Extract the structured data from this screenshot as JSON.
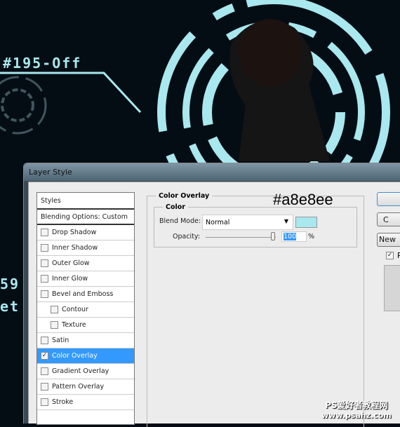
{
  "background": {
    "hud_label_top": "#195-Off",
    "hud_label_left_1": "59",
    "hud_label_left_2": "et",
    "accent": "#a8e8ee"
  },
  "dialog": {
    "title": "Layer Style",
    "styles_list": [
      {
        "label": "Styles",
        "type": "header"
      },
      {
        "label": "Blending Options: Custom",
        "type": "blend"
      },
      {
        "label": "Drop Shadow",
        "checked": false
      },
      {
        "label": "Inner Shadow",
        "checked": false
      },
      {
        "label": "Outer Glow",
        "checked": false
      },
      {
        "label": "Inner Glow",
        "checked": false
      },
      {
        "label": "Bevel and Emboss",
        "checked": false
      },
      {
        "label": "Contour",
        "checked": false,
        "sub": true
      },
      {
        "label": "Texture",
        "checked": false,
        "sub": true
      },
      {
        "label": "Satin",
        "checked": false
      },
      {
        "label": "Color Overlay",
        "checked": true,
        "selected": true
      },
      {
        "label": "Gradient Overlay",
        "checked": false
      },
      {
        "label": "Pattern Overlay",
        "checked": false
      },
      {
        "label": "Stroke",
        "checked": false
      }
    ],
    "panel": {
      "title": "Color Overlay",
      "group": "Color",
      "blend_mode_label": "Blend Mode:",
      "blend_mode": "Normal",
      "color_swatch": "#a8e8ee",
      "opacity_label": "Opacity:",
      "opacity": "100",
      "opacity_unit": "%",
      "annotation": "#a8e8ee"
    },
    "buttons": {
      "ok": "",
      "cancel": "C",
      "new_style": "New",
      "preview": "P"
    }
  },
  "watermark": {
    "line1": "PS爱好者教程网",
    "line2": "www.psahz.com"
  }
}
